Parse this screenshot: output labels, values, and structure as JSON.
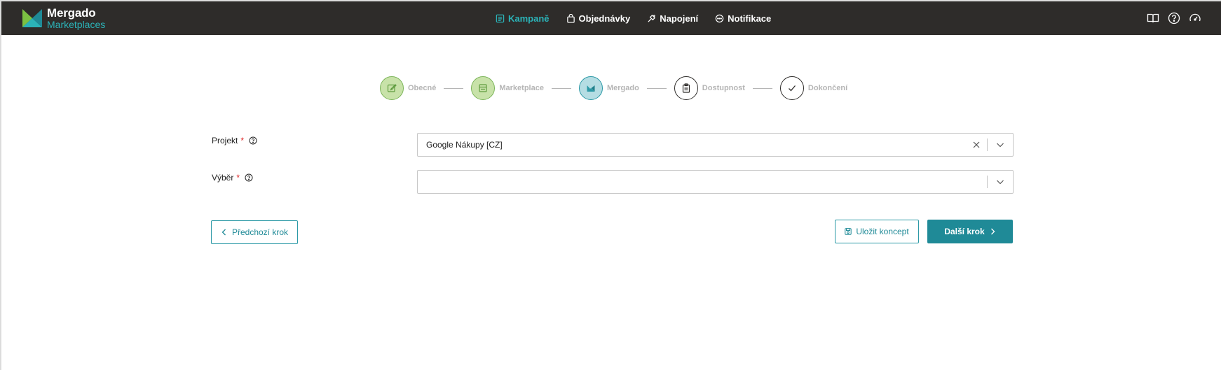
{
  "app": {
    "name": "Mergado",
    "subtitle": "Marketplaces"
  },
  "nav": {
    "items": [
      {
        "label": "Kampaně",
        "icon": "list-icon",
        "active": true
      },
      {
        "label": "Objednávky",
        "icon": "bag-icon",
        "active": false
      },
      {
        "label": "Napojení",
        "icon": "plug-icon",
        "active": false
      },
      {
        "label": "Notifikace",
        "icon": "chat-icon",
        "active": false
      }
    ],
    "right_icons": [
      "book-icon",
      "help-icon",
      "dashboard-icon"
    ]
  },
  "stepper": {
    "steps": [
      {
        "label": "Obecné",
        "state": "done",
        "icon": "edit-icon"
      },
      {
        "label": "Marketplace",
        "state": "done",
        "icon": "store-icon"
      },
      {
        "label": "Mergado",
        "state": "current",
        "icon": "mergado-icon"
      },
      {
        "label": "Dostupnost",
        "state": "pending",
        "icon": "clipboard-icon"
      },
      {
        "label": "Dokončení",
        "state": "pending",
        "icon": "check-icon"
      }
    ]
  },
  "form": {
    "project": {
      "label": "Projekt",
      "required_mark": "*",
      "value": "Google Nákupy [CZ]"
    },
    "selection": {
      "label": "Výběr",
      "required_mark": "*",
      "value": ""
    }
  },
  "actions": {
    "previous": "Předchozí krok",
    "save_draft": "Uložit koncept",
    "next": "Další krok"
  },
  "colors": {
    "accent": "#1f8a97",
    "topbar": "#2e2c2a",
    "done_step": "#c8e2a9",
    "current_step": "#b5dde3",
    "required": "#dd2222"
  }
}
